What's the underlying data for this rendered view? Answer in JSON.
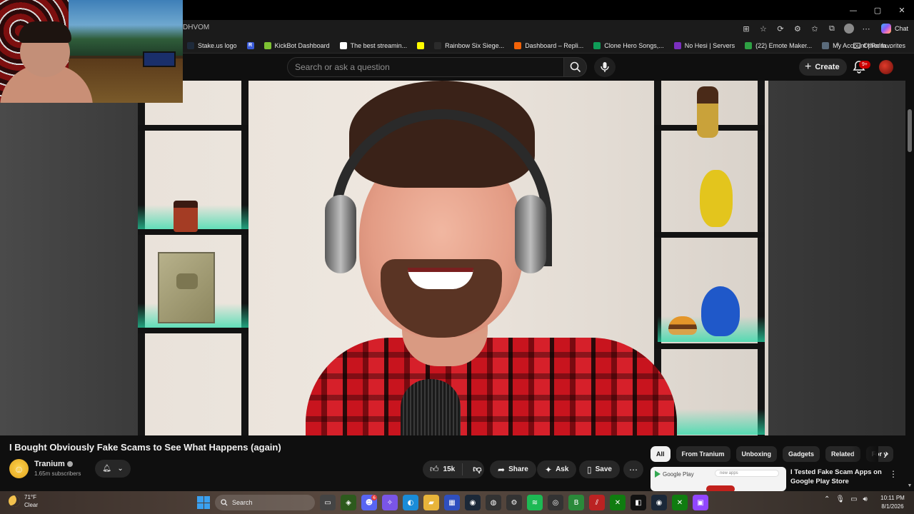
{
  "window": {
    "controls": [
      "—",
      "▢",
      "✕"
    ]
  },
  "browser": {
    "url_visible": "DHVOM",
    "chat_label": "Chat",
    "bookmarks": [
      {
        "label": "Stake.us logo",
        "icon": "stake-icon",
        "color": "#1e2a3a"
      },
      {
        "label": "",
        "icon": "r-badge-icon",
        "color": "#3a5bd9",
        "glyph": "R"
      },
      {
        "label": "KickBot Dashboard",
        "icon": "kickbot-icon",
        "color": "#7ec233"
      },
      {
        "label": "The best streamin...",
        "icon": "streaming-icon",
        "color": "#ffffff"
      },
      {
        "label": "",
        "icon": "snapchat-icon",
        "color": "#fffc00"
      },
      {
        "label": "Rainbow Six Siege...",
        "icon": "r6-icon",
        "color": "#2b2b2b"
      },
      {
        "label": "Dashboard – Repli...",
        "icon": "replit-icon",
        "color": "#f26207"
      },
      {
        "label": "Clone Hero Songs,...",
        "icon": "sheets-icon",
        "color": "#0f9d58"
      },
      {
        "label": "No Hesi | Servers",
        "icon": "nohesi-icon",
        "color": "#7b2fbf"
      },
      {
        "label": "(22) Emote Maker...",
        "icon": "emote-icon",
        "color": "#2ea043"
      },
      {
        "label": "My Account | Palm...",
        "icon": "palm-icon",
        "color": "#5a6b7b"
      }
    ],
    "more_glyph": "›",
    "other_favorites": "Other favorites"
  },
  "youtube": {
    "search_placeholder": "Search or ask a question",
    "create_label": "Create",
    "notification_count": "9+",
    "video": {
      "title": "I Bought Obviously Fake Scams to See What Happens (again)",
      "channel": "Tranium",
      "subscribers": "1.65m subscribers",
      "likes": "15k",
      "actions": {
        "share": "Share",
        "ask": "Ask",
        "save": "Save"
      }
    },
    "chips": [
      "All",
      "From Tranium",
      "Unboxing",
      "Gadgets",
      "Related",
      "For y"
    ],
    "recommendation": {
      "title": "I Tested Fake Scam Apps on Google Play Store",
      "thumb_brand": "Google Play",
      "thumb_search": "new apps"
    }
  },
  "taskbar": {
    "weather_temp": "71°F",
    "weather_desc": "Clear",
    "search_placeholder": "Search",
    "time": "10:11 PM",
    "date": "8/1/2026",
    "discord_badge": "6"
  }
}
